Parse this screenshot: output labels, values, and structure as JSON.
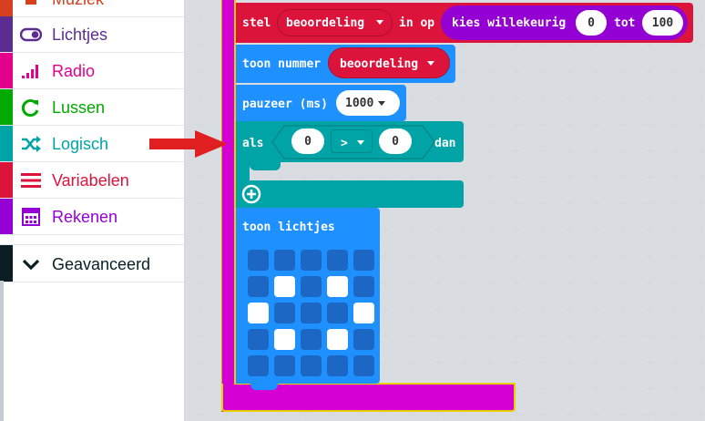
{
  "toolbox": {
    "categories": [
      {
        "label": "Muziek",
        "color": "#d6401f",
        "icon": "music-icon"
      },
      {
        "label": "Lichtjes",
        "color": "#5c2d91",
        "icon": "toggle-icon"
      },
      {
        "label": "Radio",
        "color": "#e3008c",
        "icon": "signal-bars-icon"
      },
      {
        "label": "Lussen",
        "color": "#00aa00",
        "icon": "refresh-icon"
      },
      {
        "label": "Logisch",
        "color": "#00a4a6",
        "icon": "shuffle-icon"
      },
      {
        "label": "Variabelen",
        "color": "#dc143c",
        "icon": "list-lines-icon"
      },
      {
        "label": "Rekenen",
        "color": "#9400d3",
        "icon": "calculator-icon"
      }
    ],
    "advanced": {
      "label": "Geavanceerd",
      "color": "#0a1f24",
      "icon": "chevron-down-icon"
    }
  },
  "blocks": {
    "set": {
      "keyword": "stel",
      "variable": "beoordeling",
      "into": "in op",
      "random_label": "kies willekeurig",
      "from": "0",
      "to_label": "tot",
      "to": "100"
    },
    "show_number": {
      "keyword": "toon nummer",
      "variable": "beoordeling"
    },
    "pause": {
      "keyword": "pauzeer (ms)",
      "value": "1000"
    },
    "if": {
      "keyword": "als",
      "left": "0",
      "operator": ">",
      "right": "0",
      "then": "dan"
    },
    "show_leds": {
      "keyword": "toon lichtjes",
      "grid": [
        [
          0,
          0,
          0,
          0,
          0
        ],
        [
          0,
          1,
          0,
          1,
          0
        ],
        [
          1,
          0,
          0,
          0,
          1
        ],
        [
          0,
          1,
          0,
          1,
          0
        ],
        [
          0,
          0,
          0,
          0,
          0
        ]
      ]
    }
  },
  "colors": {
    "forever": "#d400d4",
    "variables": "#dc143c",
    "math": "#9400d3",
    "basic": "#1e90ff",
    "logic": "#00a4a6",
    "arrow": "#e02020"
  }
}
